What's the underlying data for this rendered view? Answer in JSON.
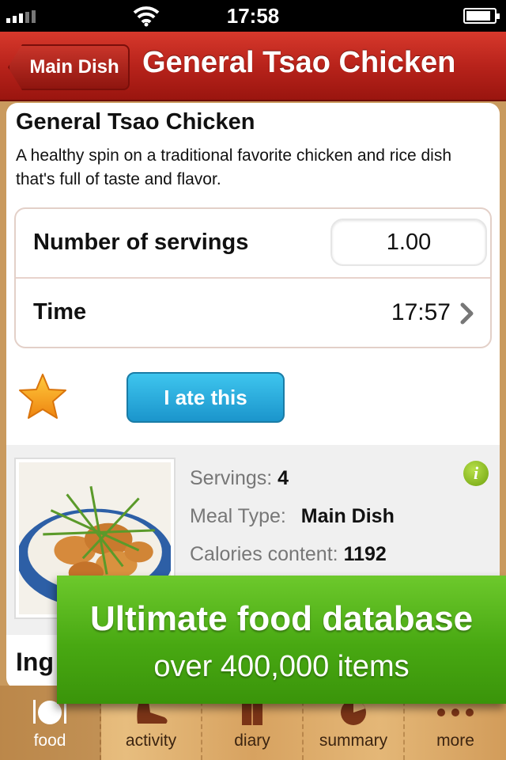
{
  "status_bar": {
    "time": "17:58",
    "signal_bars": 3,
    "battery_fraction": 0.8
  },
  "nav": {
    "back_label": "Main Dish",
    "title": "General Tsao Chicken"
  },
  "recipe": {
    "title": "General Tsao Chicken",
    "description": "A healthy spin on a traditional favorite chicken and rice dish that's full of taste and flavor."
  },
  "settings": {
    "servings_label": "Number of servings",
    "servings_value": "1.00",
    "time_label": "Time",
    "time_value": "17:57"
  },
  "actions": {
    "ate_button": "I ate this"
  },
  "info": {
    "servings_label": "Servings:",
    "servings_value": "4",
    "meal_type_label": "Meal Type:",
    "meal_type_value": "Main Dish",
    "calories_label": "Calories content:",
    "calories_value": "1192",
    "info_icon_glyph": "i"
  },
  "ingredients_heading": "Ing",
  "promo": {
    "headline": "Ultimate food database",
    "subline": "over 400,000 items"
  },
  "tabs": [
    {
      "label": "food",
      "icon": "plate-fork-knife-icon",
      "active": true
    },
    {
      "label": "activity",
      "icon": "shoe-icon",
      "active": false
    },
    {
      "label": "diary",
      "icon": "book-icon",
      "active": false
    },
    {
      "label": "summary",
      "icon": "pie-chart-icon",
      "active": false
    },
    {
      "label": "more",
      "icon": "more-dots-icon",
      "active": false
    }
  ],
  "colors": {
    "nav_red": "#b8231b",
    "button_blue": "#1b95cc",
    "promo_green": "#48a812",
    "star_orange": "#f29a14",
    "tab_wood": "#e0b273"
  }
}
